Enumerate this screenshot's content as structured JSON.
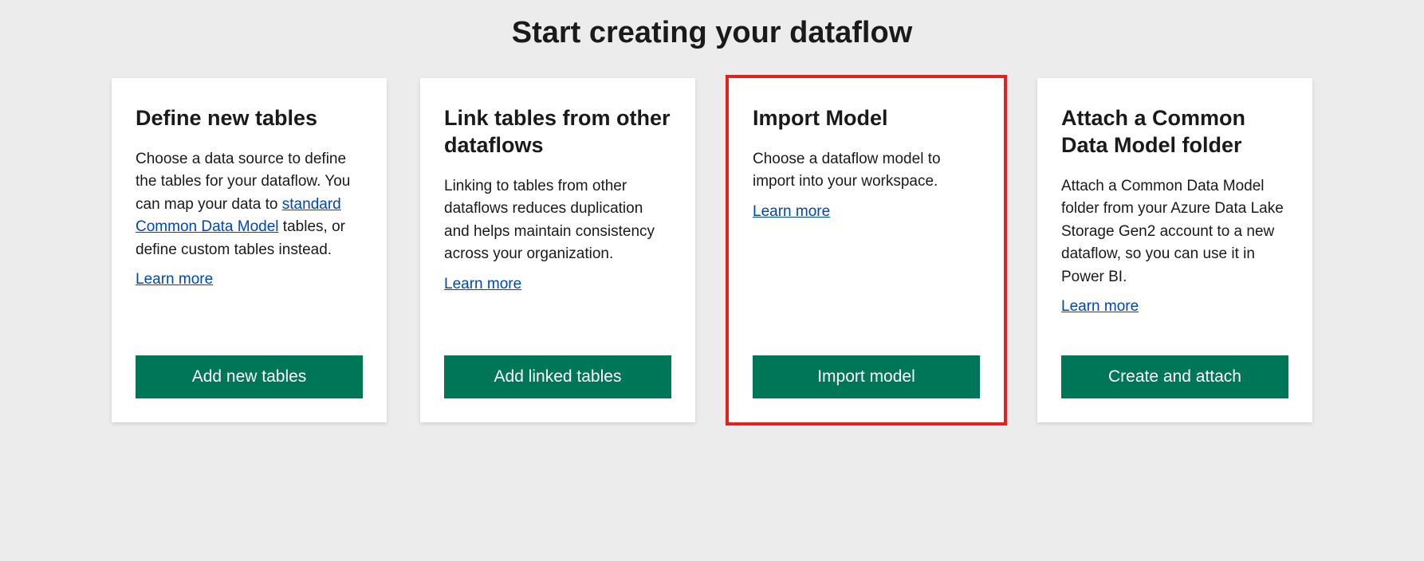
{
  "page_title": "Start creating your dataflow",
  "cards": [
    {
      "title": "Define new tables",
      "desc_pre": "Choose a data source to define the tables for your dataflow. You can map your data to ",
      "desc_link": "standard Common Data Model",
      "desc_post": " tables, or define custom tables instead.",
      "learn_more": "Learn more",
      "button": "Add new tables"
    },
    {
      "title": "Link tables from other dataflows",
      "desc_pre": "Linking to tables from other dataflows reduces duplication and helps maintain consistency across your organization.",
      "desc_link": "",
      "desc_post": "",
      "learn_more": "Learn more",
      "button": "Add linked tables"
    },
    {
      "title": "Import Model",
      "desc_pre": "Choose a dataflow model to import into your workspace.",
      "desc_link": "",
      "desc_post": "",
      "learn_more": "Learn more",
      "button": "Import model"
    },
    {
      "title": "Attach a Common Data Model folder",
      "desc_pre": "Attach a Common Data Model folder from your Azure Data Lake Storage Gen2 account to a new dataflow, so you can use it in Power BI.",
      "desc_link": "",
      "desc_post": "",
      "learn_more": "Learn more",
      "button": "Create and attach"
    }
  ]
}
